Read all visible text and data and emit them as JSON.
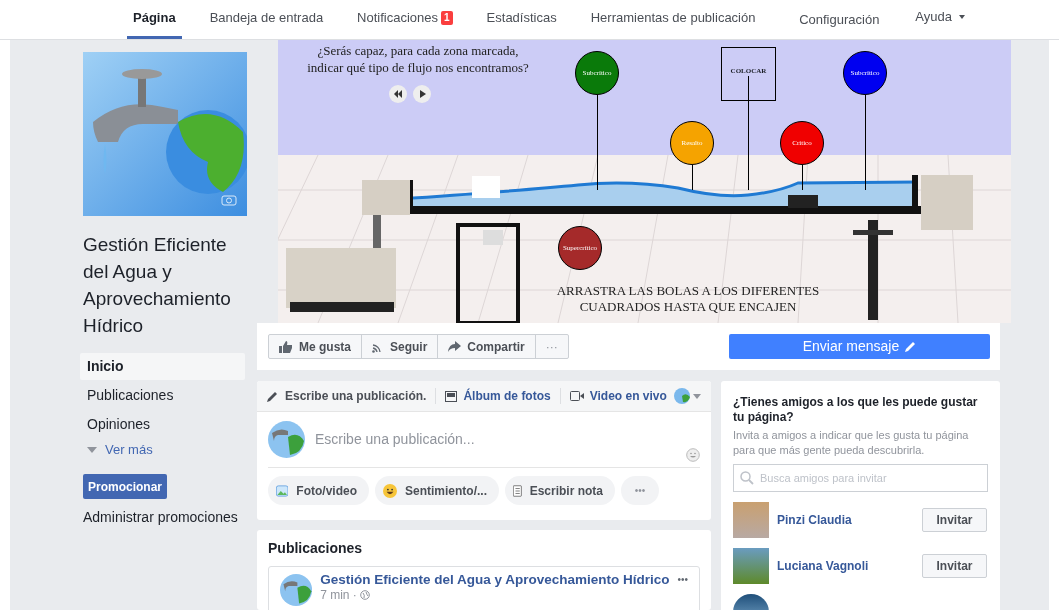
{
  "nav": {
    "tabs": [
      {
        "label": "Página",
        "selected": true
      },
      {
        "label": "Bandeja de entrada",
        "selected": false
      },
      {
        "label": "Notificaciones",
        "selected": false,
        "badge": "1"
      },
      {
        "label": "Estadísticas",
        "selected": false
      },
      {
        "label": "Herramientas de publicación",
        "selected": false
      }
    ],
    "settings": "Configuración",
    "help": "Ayuda"
  },
  "page": {
    "name": "Gestión Eficiente del Agua y Aprovechamiento Hídrico",
    "menu": [
      {
        "label": "Inicio",
        "selected": true
      },
      {
        "label": "Publicaciones",
        "selected": false
      },
      {
        "label": "Opiniones",
        "selected": false
      }
    ],
    "see_more": "Ver más",
    "promote_button": "Promocionar",
    "manage_promotions": "Administrar promociones"
  },
  "cover": {
    "question": "¿Serás capaz, para cada zona marcada, indicar qué tipo de flujo nos encontramos?",
    "instruction": "ARRASTRA LAS BOLAS A LOS DIFERENTES CUADRADOS HASTA QUE ENCAJEN",
    "drop_box": "COLOCAR",
    "balls": [
      {
        "label": "Subcrítico",
        "color": "#0a7a0a"
      },
      {
        "label": "Resalto",
        "color": "#f5a300"
      },
      {
        "label": "Crítico",
        "color": "#f00000"
      },
      {
        "label": "Subcrítico",
        "color": "#0000f0"
      },
      {
        "label": "Supercrítico",
        "color": "#a52a2a"
      }
    ]
  },
  "actions": [
    {
      "label": "Me gusta"
    },
    {
      "label": "Seguir"
    },
    {
      "label": "Compartir"
    }
  ],
  "actions_more": "···",
  "message_button": "Enviar mensaje",
  "composer": {
    "tabs": [
      {
        "label": "Escribe una publicación.",
        "selected": true
      },
      {
        "label": "Álbum de fotos",
        "selected": false
      },
      {
        "label": "Video en vivo",
        "selected": false
      }
    ],
    "placeholder": "Escribe una publicación...",
    "buttons": [
      {
        "label": "Foto/video"
      },
      {
        "label": "Sentimiento/..."
      },
      {
        "label": "Escribir nota"
      }
    ],
    "more": "•••"
  },
  "invite": {
    "title": "¿Tienes amigos a los que les puede gustar tu página?",
    "subtitle": "Invita a amigos a indicar que les gusta tu página para que más gente pueda descubrirla.",
    "search_placeholder": "Busca amigos para invitar",
    "friends": [
      {
        "name": "Pinzi Claudia",
        "button": "Invitar"
      },
      {
        "name": "Luciana Vagnoli",
        "button": "Invitar"
      }
    ]
  },
  "posts": {
    "title": "Publicaciones",
    "post": {
      "author": "Gestión Eficiente del Agua y Aprovechamiento Hídrico",
      "time": "7 min ·",
      "more": "•••"
    }
  }
}
